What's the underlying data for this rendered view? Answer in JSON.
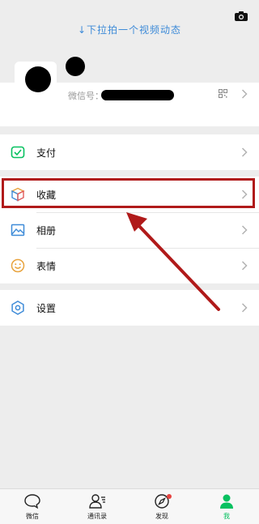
{
  "top": {
    "pull_hint": "↓下拉拍一个视频动态"
  },
  "profile": {
    "wechat_id_label": "微信号："
  },
  "menu": {
    "pay": "支付",
    "favorites": "收藏",
    "album": "相册",
    "stickers": "表情",
    "settings": "设置"
  },
  "tabbar": {
    "chats": "微信",
    "contacts": "通讯录",
    "discover": "发现",
    "me": "我"
  },
  "colors": {
    "accent": "#07c160",
    "highlight": "#b01a1a",
    "badge": "#e64340"
  }
}
